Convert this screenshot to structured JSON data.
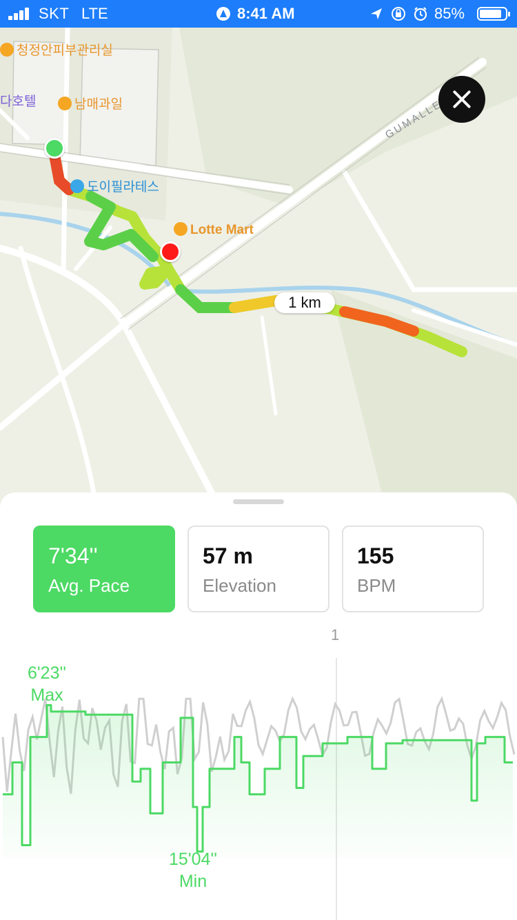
{
  "status_bar": {
    "carrier": "SKT",
    "network": "LTE",
    "time": "8:41 AM",
    "battery": "85%",
    "battery_fraction": 0.85,
    "signal_bars": 4,
    "icons": [
      "location-icon",
      "orientation-lock-icon",
      "alarm-icon"
    ]
  },
  "map": {
    "pois": [
      {
        "name": "청정안피부관리실",
        "icon": "spa-icon"
      },
      {
        "name": "다호텔",
        "icon": ""
      },
      {
        "name": "남매과일",
        "icon": "basket-icon"
      },
      {
        "name": "도이필라테스",
        "icon": "dumbbell-icon"
      },
      {
        "name": "Lotte Mart",
        "icon": "shopping-bag-icon"
      }
    ],
    "road_label": "GUMALLEE-GIL",
    "distance_marker": "1 km",
    "start_pin_color": "#4cd964",
    "end_pin_color": "#ff1a1a"
  },
  "close_button": {
    "icon": "close-icon"
  },
  "stats": [
    {
      "value": "7'34''",
      "label": "Avg. Pace",
      "active": true
    },
    {
      "value": "57 m",
      "label": "Elevation",
      "active": false
    },
    {
      "value": "155",
      "label": "BPM",
      "active": false
    }
  ],
  "chart_data": {
    "type": "line",
    "x_tick_labels": [
      "1"
    ],
    "annotations": {
      "max_value": "6'23''",
      "max_label": "Max",
      "min_value": "15'04''",
      "min_label": "Min"
    },
    "series": [
      {
        "color": "#4cd964",
        "values": [
          7.8,
          7.8,
          7.8,
          8.6,
          8.6,
          8.6,
          8.6,
          8.6,
          8.6,
          8.6,
          8.6,
          8.6,
          7.7,
          7.7,
          7.7,
          7.7,
          7.9,
          7.9,
          7.4,
          7.4,
          6.5,
          6.4,
          6.5,
          6.6,
          6.6,
          6.6,
          6.6,
          6.6,
          6.6,
          6.6,
          6.6,
          6.6,
          6.6,
          6.6,
          6.6,
          6.6,
          6.6,
          6.6,
          6.6,
          6.6,
          6.6,
          6.6,
          6.6,
          6.6,
          6.6,
          6.6,
          6.6,
          6.6,
          6.6,
          6.6,
          6.6,
          6.6,
          6.6,
          6.6,
          6.6,
          6.6,
          6.6,
          6.6,
          6.6,
          6.6,
          6.6,
          6.6,
          6.6,
          6.6,
          6.6,
          6.6,
          6.6,
          6.6,
          6.6,
          6.6,
          6.6,
          6.6,
          6.6,
          6.6,
          6.6,
          6.6,
          6.6,
          6.6,
          6.6,
          6.6,
          6.6,
          6.6,
          6.6,
          6.6,
          6.6,
          6.6,
          6.6,
          6.6,
          6.6,
          6.6,
          6.6,
          6.6,
          6.6,
          6.6,
          6.6,
          6.6,
          6.6,
          6.6,
          6.6,
          6.6,
          6.6,
          6.6,
          6.6,
          6.6,
          6.6,
          6.6,
          6.6,
          6.6,
          6.6,
          6.6,
          6.6,
          6.6,
          6.6,
          6.6,
          6.6,
          6.6,
          6.6,
          6.6,
          6.6,
          6.6,
          6.6,
          6.6,
          6.6,
          6.6,
          6.6,
          6.6,
          6.6,
          6.6,
          6.6,
          6.6,
          6.6,
          6.6,
          6.6,
          6.6,
          6.6,
          6.6,
          6.6,
          6.6,
          6.6,
          6.6,
          6.6,
          6.6,
          6.6,
          6.6,
          6.6,
          6.6,
          6.6,
          6.6,
          6.6,
          6.6,
          6.6,
          6.6,
          6.6,
          6.6,
          6.6,
          6.6,
          6.6,
          6.6,
          6.6,
          6.6,
          6.6,
          6.6,
          6.6,
          6.6,
          6.6,
          6.6,
          6.6,
          6.6,
          6.6,
          6.6,
          6.6,
          6.6,
          6.6,
          6.6,
          6.6,
          6.6,
          6.6,
          6.6,
          6.6,
          6.6,
          6.6,
          6.6,
          6.6,
          6.6,
          6.6,
          6.6,
          6.6,
          6.6,
          6.6,
          6.6,
          6.6,
          6.6,
          6.6,
          6.6,
          6.6,
          6.6,
          6.6,
          6.6,
          6.6,
          6.6,
          6.6,
          6.6,
          6.6,
          6.6,
          6.6,
          6.6,
          6.6,
          6.6,
          6.6,
          6.6,
          6.6,
          6.6,
          6.6,
          6.6,
          6.6
        ]
      },
      {
        "color": "#cfcfcf",
        "values": [
          6.5,
          6.2,
          7.6,
          6.6,
          7.3,
          7.0
        ]
      }
    ]
  }
}
